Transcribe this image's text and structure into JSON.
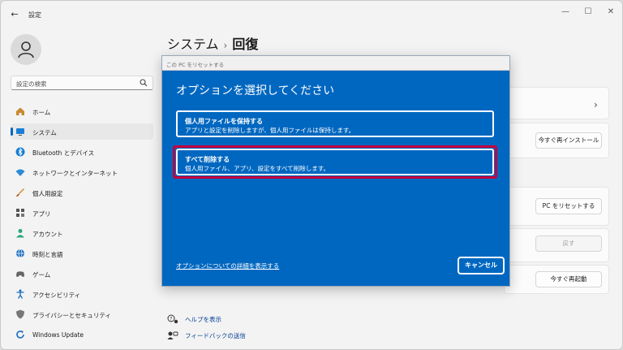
{
  "app": {
    "title": "設定"
  },
  "search": {
    "placeholder": "設定の検索"
  },
  "sidebar": {
    "items": [
      {
        "label": "ホーム",
        "icon": "home-icon"
      },
      {
        "label": "システム",
        "icon": "monitor-icon",
        "active": true
      },
      {
        "label": "Bluetooth とデバイス",
        "icon": "bluetooth-icon"
      },
      {
        "label": "ネットワークとインターネット",
        "icon": "wifi-icon"
      },
      {
        "label": "個人用設定",
        "icon": "brush-icon"
      },
      {
        "label": "アプリ",
        "icon": "apps-icon"
      },
      {
        "label": "アカウント",
        "icon": "person-icon"
      },
      {
        "label": "時刻と言語",
        "icon": "globe-clock-icon"
      },
      {
        "label": "ゲーム",
        "icon": "gamepad-icon"
      },
      {
        "label": "アクセシビリティ",
        "icon": "accessibility-icon"
      },
      {
        "label": "プライバシーとセキュリティ",
        "icon": "shield-icon"
      },
      {
        "label": "Windows Update",
        "icon": "update-icon"
      }
    ]
  },
  "breadcrumb": {
    "parent": "システム",
    "separator": "›",
    "current": "回復"
  },
  "cards": {
    "reinstall_label": "今すぐ再インストール",
    "reset_label": "PC をリセットする",
    "back_label": "戻す",
    "restart_label": "今すぐ再起動"
  },
  "links": {
    "help": "ヘルプを表示",
    "feedback": "フィードバックの送信"
  },
  "dialog": {
    "window_title": "この PC をリセットする",
    "heading": "オプションを選択してください",
    "options": [
      {
        "title": "個人用ファイルを保持する",
        "desc": "アプリと設定を削除しますが、個人用ファイルは保持します。"
      },
      {
        "title": "すべて削除する",
        "desc": "個人用ファイル、アプリ、設定をすべて削除します。"
      }
    ],
    "more_info_link": "オプションについての詳細を表示する",
    "cancel_label": "キャンセル"
  },
  "colors": {
    "dialog_bg": "#0067c0",
    "highlight": "#c4003c",
    "accent": "#0067c0"
  }
}
